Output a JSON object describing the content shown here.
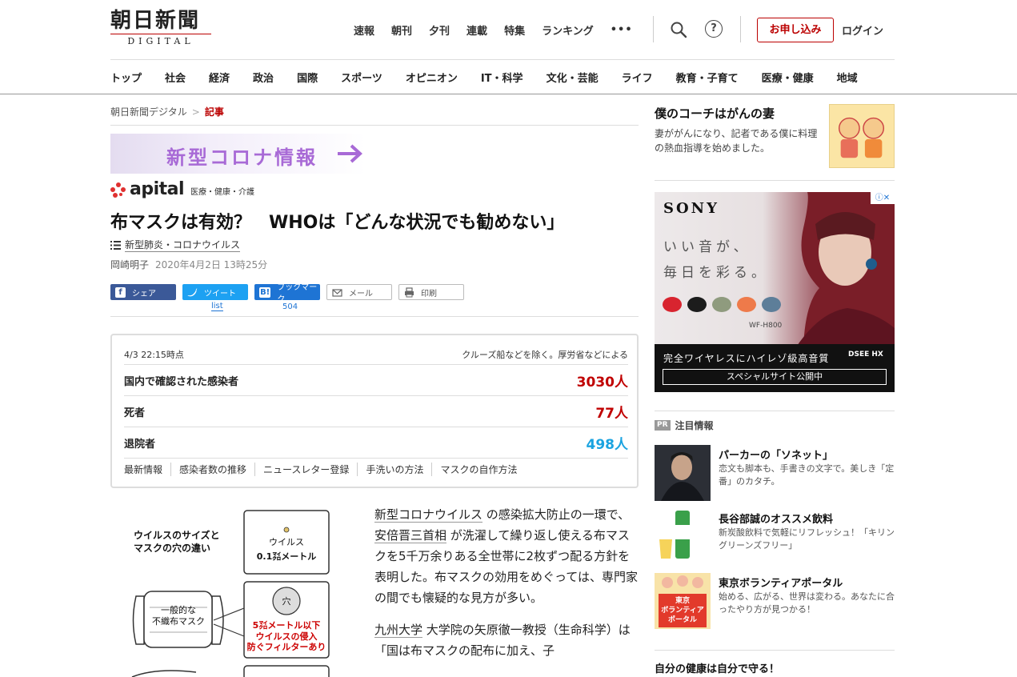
{
  "header": {
    "logo_main": "朝日新聞",
    "logo_sub": "DIGITAL",
    "top_nav": [
      "速報",
      "朝刊",
      "夕刊",
      "連載",
      "特集",
      "ランキング"
    ],
    "more_label": "•••",
    "help_label": "?",
    "apply_label": "お申し込み",
    "login_label": "ログイン",
    "categories": [
      "トップ",
      "社会",
      "経済",
      "政治",
      "国際",
      "スポーツ",
      "オピニオン",
      "IT・科学",
      "文化・芸能",
      "ライフ",
      "教育・子育て",
      "医療・健康",
      "地域"
    ]
  },
  "breadcrumb": {
    "home": "朝日新聞デジタル",
    "separator": ">",
    "current": "記事"
  },
  "banner": {
    "text": "新型コロナ情報"
  },
  "apital": {
    "wordmark": "apital",
    "tagline": "医療・健康・介護"
  },
  "article": {
    "headline": "布マスクは有効？　WHOは「どんな状況でも勧めない」",
    "topic": "新型肺炎・コロナウイルス",
    "author": "岡崎明子",
    "date": "2020年4月2日 13時25分",
    "paragraphs": [
      {
        "link": "新型コロナウイルス",
        "text_1": " の感染拡大防止の一環で、 ",
        "link_2": "安倍晋三首相",
        "text_2": " が洗濯して繰り返し使える布マスクを5千万余りある全世帯に2枚ずつ配る方針を表明した。布マスクの効用をめぐっては、専門家の間でも懐疑的な見方が多い。"
      },
      {
        "link": "九州大学",
        "text_1": " 大学院の矢原徹一教授（生命科学）は「国は布マスクの配布に加え、子"
      }
    ]
  },
  "share": {
    "facebook": "シェア",
    "twitter": "ツイート",
    "twitter_count": "list",
    "hatena": "ブックマーク",
    "hatena_count": "504",
    "mail": "メール",
    "print": "印刷"
  },
  "stats": {
    "timestamp": "4/3 22:15時点",
    "note": "クルーズ船などを除く。厚労省などによる",
    "rows": [
      {
        "label": "国内で確認された感染者",
        "value": "3030人"
      },
      {
        "label": "死者",
        "value": "77人"
      },
      {
        "label": "退院者",
        "value": "498人"
      }
    ],
    "links": [
      "最新情報",
      "感染者数の推移",
      "ニュースレター登録",
      "手洗いの方法",
      "マスクの自作方法"
    ]
  },
  "figure": {
    "title": "ウイルスのサイズと\nマスクの穴の違い",
    "virus_label": "ウイルス",
    "virus_size": "0.1㍃メートル",
    "hole_label": "穴",
    "mask_label": "一般的な\n不織布マスク",
    "hole_size": "5㍃メートル以下",
    "hole_note": "ウイルスの侵入\n防ぐフィルターあり"
  },
  "sidebar": {
    "feature_title": "僕のコーチはがんの妻",
    "feature_text": "妻ががんになり、記者である僕に料理の熱血指導を始めました。",
    "ad": {
      "brand": "SONY",
      "copy_1": "いい音が、",
      "copy_2": "毎日を彩る。",
      "model": "WF-H800",
      "band_copy": "完全ワイヤレスにハイレゾ級高音質",
      "band_logo": "DSEE HX",
      "button": "スペシャルサイト公開中",
      "choice": "ⓘ✕",
      "bud_colors": [
        "#d8242f",
        "#1c1c1c",
        "#8f9b7e",
        "#ee7a4a",
        "#5d7e99"
      ]
    },
    "pr_badge": "PR",
    "pr_title": "注目情報",
    "pr_items": [
      {
        "title": "パーカーの「ソネット」",
        "text": "恋文も脚本も、手書きの文字で。美しき「定番」のカタチ。"
      },
      {
        "title": "長谷部誠のオススメ飲料",
        "text": "新炭酸飲料で気軽にリフレッシュ！「キリン グリーンズフリー」"
      },
      {
        "title": "東京ボランティアポータル",
        "text": "始める、広がる、世界は変わる。あなたに合ったやり方が見つかる！",
        "thumb_text": "東京\nボランティア\nポータル"
      }
    ],
    "bottom_title": "自分の健康は自分で守る！"
  }
}
